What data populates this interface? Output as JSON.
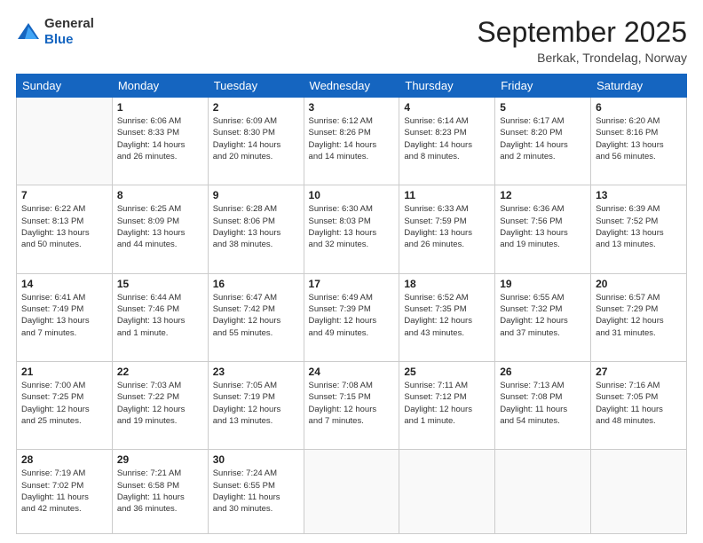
{
  "header": {
    "logo": {
      "general": "General",
      "blue": "Blue"
    },
    "month": "September 2025",
    "location": "Berkak, Trondelag, Norway"
  },
  "days_of_week": [
    "Sunday",
    "Monday",
    "Tuesday",
    "Wednesday",
    "Thursday",
    "Friday",
    "Saturday"
  ],
  "weeks": [
    [
      {
        "day": "",
        "info": ""
      },
      {
        "day": "1",
        "info": "Sunrise: 6:06 AM\nSunset: 8:33 PM\nDaylight: 14 hours\nand 26 minutes."
      },
      {
        "day": "2",
        "info": "Sunrise: 6:09 AM\nSunset: 8:30 PM\nDaylight: 14 hours\nand 20 minutes."
      },
      {
        "day": "3",
        "info": "Sunrise: 6:12 AM\nSunset: 8:26 PM\nDaylight: 14 hours\nand 14 minutes."
      },
      {
        "day": "4",
        "info": "Sunrise: 6:14 AM\nSunset: 8:23 PM\nDaylight: 14 hours\nand 8 minutes."
      },
      {
        "day": "5",
        "info": "Sunrise: 6:17 AM\nSunset: 8:20 PM\nDaylight: 14 hours\nand 2 minutes."
      },
      {
        "day": "6",
        "info": "Sunrise: 6:20 AM\nSunset: 8:16 PM\nDaylight: 13 hours\nand 56 minutes."
      }
    ],
    [
      {
        "day": "7",
        "info": "Sunrise: 6:22 AM\nSunset: 8:13 PM\nDaylight: 13 hours\nand 50 minutes."
      },
      {
        "day": "8",
        "info": "Sunrise: 6:25 AM\nSunset: 8:09 PM\nDaylight: 13 hours\nand 44 minutes."
      },
      {
        "day": "9",
        "info": "Sunrise: 6:28 AM\nSunset: 8:06 PM\nDaylight: 13 hours\nand 38 minutes."
      },
      {
        "day": "10",
        "info": "Sunrise: 6:30 AM\nSunset: 8:03 PM\nDaylight: 13 hours\nand 32 minutes."
      },
      {
        "day": "11",
        "info": "Sunrise: 6:33 AM\nSunset: 7:59 PM\nDaylight: 13 hours\nand 26 minutes."
      },
      {
        "day": "12",
        "info": "Sunrise: 6:36 AM\nSunset: 7:56 PM\nDaylight: 13 hours\nand 19 minutes."
      },
      {
        "day": "13",
        "info": "Sunrise: 6:39 AM\nSunset: 7:52 PM\nDaylight: 13 hours\nand 13 minutes."
      }
    ],
    [
      {
        "day": "14",
        "info": "Sunrise: 6:41 AM\nSunset: 7:49 PM\nDaylight: 13 hours\nand 7 minutes."
      },
      {
        "day": "15",
        "info": "Sunrise: 6:44 AM\nSunset: 7:46 PM\nDaylight: 13 hours\nand 1 minute."
      },
      {
        "day": "16",
        "info": "Sunrise: 6:47 AM\nSunset: 7:42 PM\nDaylight: 12 hours\nand 55 minutes."
      },
      {
        "day": "17",
        "info": "Sunrise: 6:49 AM\nSunset: 7:39 PM\nDaylight: 12 hours\nand 49 minutes."
      },
      {
        "day": "18",
        "info": "Sunrise: 6:52 AM\nSunset: 7:35 PM\nDaylight: 12 hours\nand 43 minutes."
      },
      {
        "day": "19",
        "info": "Sunrise: 6:55 AM\nSunset: 7:32 PM\nDaylight: 12 hours\nand 37 minutes."
      },
      {
        "day": "20",
        "info": "Sunrise: 6:57 AM\nSunset: 7:29 PM\nDaylight: 12 hours\nand 31 minutes."
      }
    ],
    [
      {
        "day": "21",
        "info": "Sunrise: 7:00 AM\nSunset: 7:25 PM\nDaylight: 12 hours\nand 25 minutes."
      },
      {
        "day": "22",
        "info": "Sunrise: 7:03 AM\nSunset: 7:22 PM\nDaylight: 12 hours\nand 19 minutes."
      },
      {
        "day": "23",
        "info": "Sunrise: 7:05 AM\nSunset: 7:19 PM\nDaylight: 12 hours\nand 13 minutes."
      },
      {
        "day": "24",
        "info": "Sunrise: 7:08 AM\nSunset: 7:15 PM\nDaylight: 12 hours\nand 7 minutes."
      },
      {
        "day": "25",
        "info": "Sunrise: 7:11 AM\nSunset: 7:12 PM\nDaylight: 12 hours\nand 1 minute."
      },
      {
        "day": "26",
        "info": "Sunrise: 7:13 AM\nSunset: 7:08 PM\nDaylight: 11 hours\nand 54 minutes."
      },
      {
        "day": "27",
        "info": "Sunrise: 7:16 AM\nSunset: 7:05 PM\nDaylight: 11 hours\nand 48 minutes."
      }
    ],
    [
      {
        "day": "28",
        "info": "Sunrise: 7:19 AM\nSunset: 7:02 PM\nDaylight: 11 hours\nand 42 minutes."
      },
      {
        "day": "29",
        "info": "Sunrise: 7:21 AM\nSunset: 6:58 PM\nDaylight: 11 hours\nand 36 minutes."
      },
      {
        "day": "30",
        "info": "Sunrise: 7:24 AM\nSunset: 6:55 PM\nDaylight: 11 hours\nand 30 minutes."
      },
      {
        "day": "",
        "info": ""
      },
      {
        "day": "",
        "info": ""
      },
      {
        "day": "",
        "info": ""
      },
      {
        "day": "",
        "info": ""
      }
    ]
  ]
}
